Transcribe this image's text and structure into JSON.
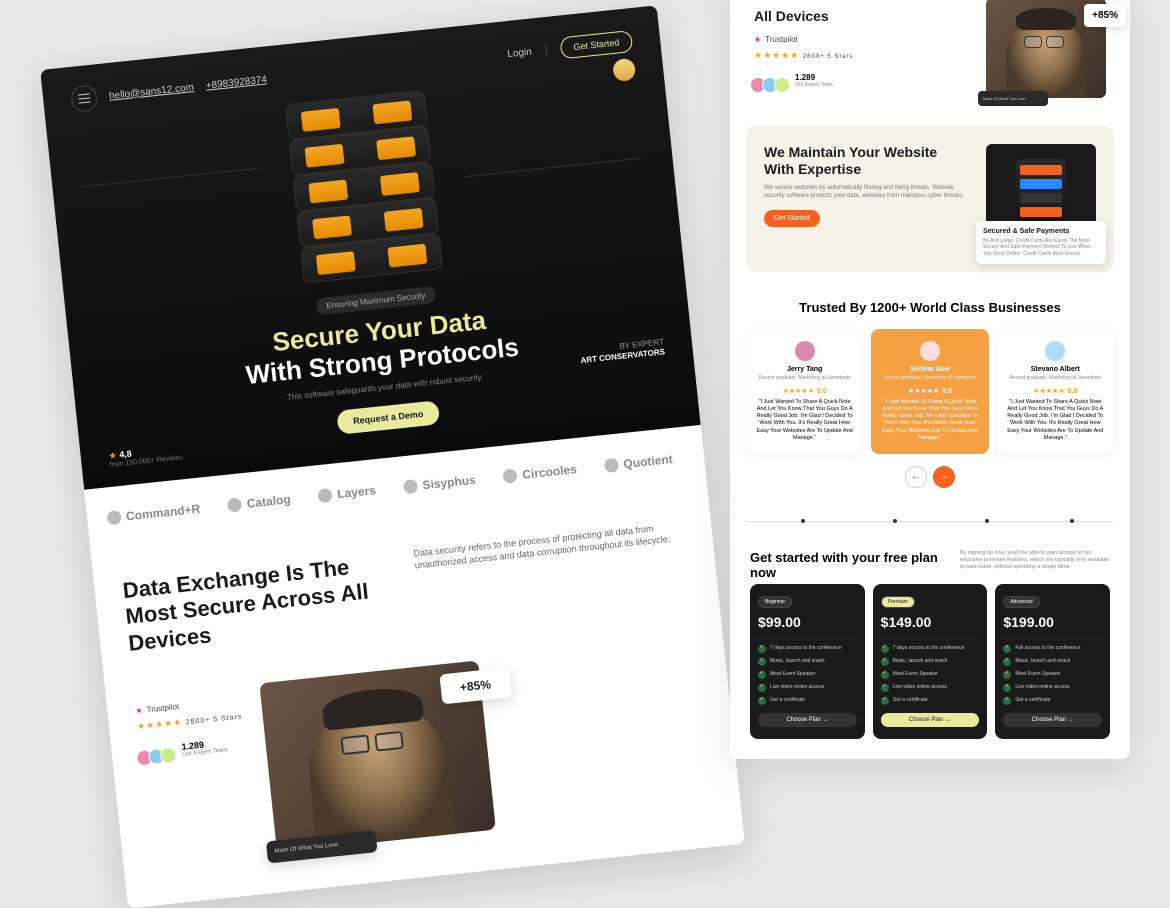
{
  "header": {
    "email": "hello@sans12.com",
    "phone": "+8983928374",
    "login": "Login",
    "get_started": "Get Started"
  },
  "hero": {
    "badge": "Ensuring Maximum Security",
    "title_line1": "Secure Your Data",
    "title_line2": "With Strong Protocols",
    "subtitle": "This software safeguards your data with robust security.",
    "byline_pre": "BY EXPERT",
    "byline_main": "ART CONSERVATORS",
    "cta": "Request a Demo",
    "rating": "4,8",
    "rating_sub": "from 150,000+ Reviews"
  },
  "logos": [
    "Command+R",
    "Catalog",
    "Layers",
    "Sisyphus",
    "Circooles",
    "Quotient"
  ],
  "data_exchange": {
    "heading": "Data Exchange Is The Most Secure Across All Devices",
    "desc": "Data security refers to the process of protecting all data from unauthorized access and data corruption throughout its lifecycle.",
    "overlay_percent": "+85%",
    "overlay_caption": "More Of What You Love",
    "trustpilot": "Trustpilot",
    "stars_text": "2800+ 5 Stars",
    "team_count": "1.289",
    "team_label": "Our Expert Team"
  },
  "maintain": {
    "heading": "We Maintain Your Website With Expertise",
    "desc": "We secure websites by automatically finding and fixing threats. Website security software protects your data, websites from malicious cyber threats.",
    "cta": "Get Started",
    "card_title": "Secured & Safe Payments",
    "card_desc": "By And Large, Credit Cards Are Easily The Most Secure And Safe Payment Method To Use When You Shop Online. Credit Cards Most Secure"
  },
  "testimonials": {
    "heading": "Trusted By 1200+ World Class Businesses",
    "items": [
      {
        "name": "Jerry Tang",
        "role": "Recent graduate, Marketing at Sweetpots",
        "rating": "5.0",
        "quote": "\"I Just Wanted To Share A Quick Note And Let You Know That You Guys Do A Really Good Job. I'm Glad I Decided To Work With You. It's Really Great How Easy Your Websites Are To Update And Manage.\""
      },
      {
        "name": "Serlina Savi",
        "role": "Recent graduate, Marketing of Sweetpots",
        "rating": "5.0",
        "quote": "\"I Just Wanted To Share A Quick Note And Let You Know That You Guys Do A Really Good Job. I'm Glad I Decided To Work With You. It's Really Great How Easy Your Websites Are To Update And Manage.\""
      },
      {
        "name": "Stevano Albert",
        "role": "Recent graduate, Marketing at Sweetpots",
        "rating": "5.0",
        "quote": "\"I Just Wanted To Share A Quick Note And Let You Know That You Guys Do A Really Good Job. I'm Glad I Decided To Work With You. It's Really Great How Easy Your Websites Are To Update And Manage.\""
      }
    ]
  },
  "pricing": {
    "heading": "Get started with your free plan now",
    "sub": "By signing up now, you'll be able to gain access to our exclusive premium features, which are typically only available to paid users, without spending a single dime.",
    "plans": [
      {
        "badge": "Beginner",
        "price": "$99.00",
        "features": [
          "7 days access to the conference",
          "Music, launch and snack",
          "Meet Event Speaker",
          "Live video online access",
          "Get a certificate"
        ],
        "cta": "Choose Plan →"
      },
      {
        "badge": "Premium",
        "price": "$149.00",
        "features": [
          "7 days access to the conference",
          "Music, launch and snack",
          "Meet Event Speaker",
          "Live video online access",
          "Get a certificate"
        ],
        "cta": "Choose Plan →"
      },
      {
        "badge": "Advanced",
        "price": "$199.00",
        "features": [
          "Full access to the conference",
          "Music, launch and snack",
          "Meet Event Speaker",
          "Live video online access",
          "Get a certificate"
        ],
        "cta": "Choose Plan →"
      }
    ]
  }
}
